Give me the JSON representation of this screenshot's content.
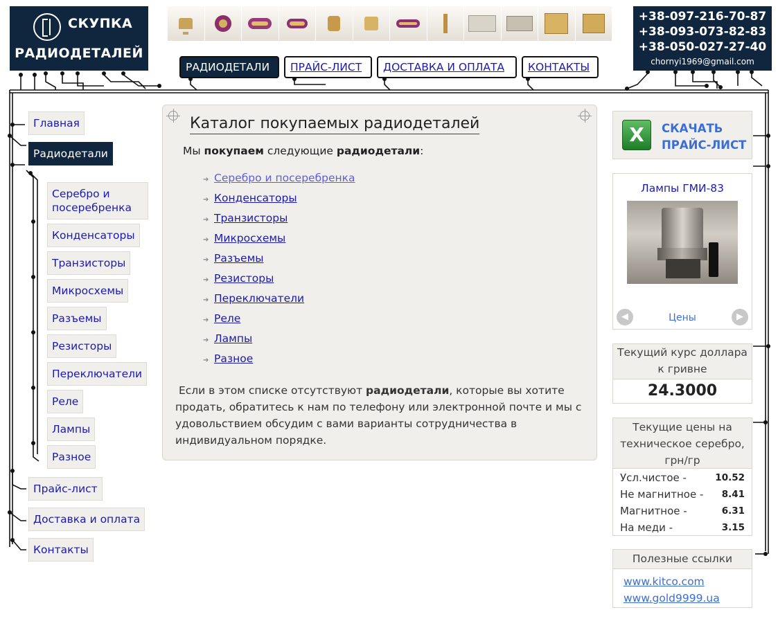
{
  "logo": {
    "line1": "СКУПКА",
    "line2": "РАДИОДЕТАЛЕЙ"
  },
  "contacts": {
    "phones": [
      "+38-097-216-70-87",
      "+38-093-073-82-83",
      "+38-050-027-27-40"
    ],
    "email": "chornyi1969@gmail.com"
  },
  "top_nav": [
    {
      "label": "РАДИОДЕТАЛИ",
      "active": true
    },
    {
      "label": "ПРАЙС-ЛИСТ",
      "active": false
    },
    {
      "label": "ДОСТАВКА И ОПЛАТА",
      "active": false
    },
    {
      "label": "КОНТАКТЫ",
      "active": false
    }
  ],
  "side_nav": {
    "main": "Главная",
    "parts": "Радиодетали",
    "sub": [
      {
        "label": "Серебро и\nпосеребренка"
      },
      {
        "label": "Конденсаторы"
      },
      {
        "label": "Транзисторы"
      },
      {
        "label": "Микросхемы"
      },
      {
        "label": "Разъемы"
      },
      {
        "label": "Резисторы"
      },
      {
        "label": "Переключатели"
      },
      {
        "label": "Реле"
      },
      {
        "label": "Лампы"
      },
      {
        "label": "Разное"
      }
    ],
    "price": "Прайс-лист",
    "delivery": "Доставка и оплата",
    "contacts": "Контакты"
  },
  "main": {
    "title": "Каталог покупаемых радиодеталей",
    "intro": {
      "before": "Мы ",
      "bold1": "покупаем",
      "middle": " следующие ",
      "bold2": "радиодетали",
      "after": ":"
    },
    "items": [
      "Серебро и посеребренка",
      "Конденсаторы",
      "Транзисторы",
      "Микросхемы",
      "Разъемы",
      "Резисторы",
      "Переключатели",
      "Реле",
      "Лампы",
      "Разное"
    ],
    "outro": {
      "before": "Если в этом списке отсутствуют ",
      "bold": "радиодетали",
      "after": ", которые вы хотите продать, обратитесь к нам по телефону или электронной почте и мы с удовольствием обсудим с вами варианты сотрудничества в индивидуальном порядке."
    }
  },
  "download": {
    "line1": "СКАЧАТЬ",
    "line2": "ПРАЙС-ЛИСТ",
    "icon": "excel-icon"
  },
  "gallery": {
    "title": "Лампы ГМИ-83",
    "link": "Цены"
  },
  "rate": {
    "title": "Текущий курс доллара к гривне",
    "value": "24.3000"
  },
  "silver": {
    "title": "Текущие цены на техническое серебро, грн/гр",
    "rows": [
      {
        "label": "Усл.чистое -",
        "value": "10.52"
      },
      {
        "label": "Не магнитное -",
        "value": "8.41"
      },
      {
        "label": "Магнитное -",
        "value": "6.31"
      },
      {
        "label": "На меди -",
        "value": "3.15"
      }
    ]
  },
  "links": {
    "title": "Полезные ссылки",
    "items": [
      "www.kitco.com",
      "www.gold9999.ua"
    ]
  },
  "colors": {
    "navy": "#10263f",
    "link": "#1a1ab0",
    "panel": "#f1efec"
  }
}
